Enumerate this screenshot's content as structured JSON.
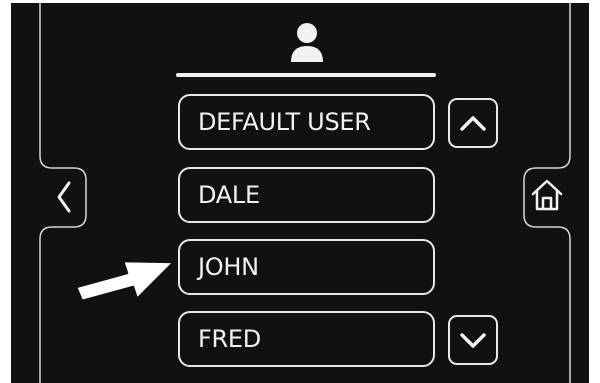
{
  "header": {
    "icon": "user-icon"
  },
  "users": [
    {
      "label": "DEFAULT USER"
    },
    {
      "label": "DALE"
    },
    {
      "label": "JOHN"
    },
    {
      "label": "FRED"
    }
  ],
  "controls": {
    "scroll_up_icon": "chevron-up-icon",
    "scroll_down_icon": "chevron-down-icon",
    "back_icon": "chevron-left-icon",
    "home_icon": "home-icon"
  },
  "annotation": {
    "pointer_icon": "arrow-pointer-icon",
    "points_to": "JOHN"
  },
  "colors": {
    "background": "#111111",
    "foreground": "#f2f2f2",
    "outline": "#e8e8e8",
    "page": "#ffffff"
  }
}
